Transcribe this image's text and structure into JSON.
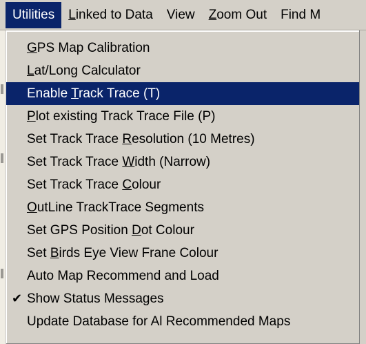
{
  "menubar": {
    "items": [
      {
        "pre": "",
        "u": "",
        "post": "Utilities"
      },
      {
        "pre": "",
        "u": "L",
        "post": "inked to Data"
      },
      {
        "pre": "",
        "u": "",
        "post": "View"
      },
      {
        "pre": "",
        "u": "Z",
        "post": "oom Out"
      },
      {
        "pre": "",
        "u": "",
        "post": "Find M"
      }
    ]
  },
  "dropdown": {
    "items": [
      {
        "pre": "",
        "u": "G",
        "post": "PS Map Calibration"
      },
      {
        "pre": "",
        "u": "L",
        "post": "at/Long Calculator"
      },
      {
        "pre": "Enable ",
        "u": "T",
        "post": "rack Trace (T)"
      },
      {
        "pre": "",
        "u": "P",
        "post": "lot existing Track Trace File (P)"
      },
      {
        "pre": "Set Track Trace ",
        "u": "R",
        "post": "esolution  (10 Metres)"
      },
      {
        "pre": "Set Track Trace ",
        "u": "W",
        "post": "idth   (Narrow)"
      },
      {
        "pre": "Set Track Trace  ",
        "u": "C",
        "post": "olour"
      },
      {
        "pre": "",
        "u": "O",
        "post": "utLine TrackTrace Segments"
      },
      {
        "pre": "Set GPS Position ",
        "u": "D",
        "post": "ot Colour"
      },
      {
        "pre": "Set ",
        "u": "B",
        "post": "irds Eye View Frane Colour"
      },
      {
        "pre": "",
        "u": "",
        "post": "Auto Map Recommend and Load"
      },
      {
        "pre": "",
        "u": "",
        "post": "Show Status Messages",
        "checked": "✔"
      },
      {
        "pre": "",
        "u": "",
        "post": "Update Database for Al Recommended Maps"
      }
    ]
  },
  "colors": {
    "menu_bg": "#d4d0c8",
    "highlight": "#0a246a",
    "highlight_text": "#ffffff"
  }
}
